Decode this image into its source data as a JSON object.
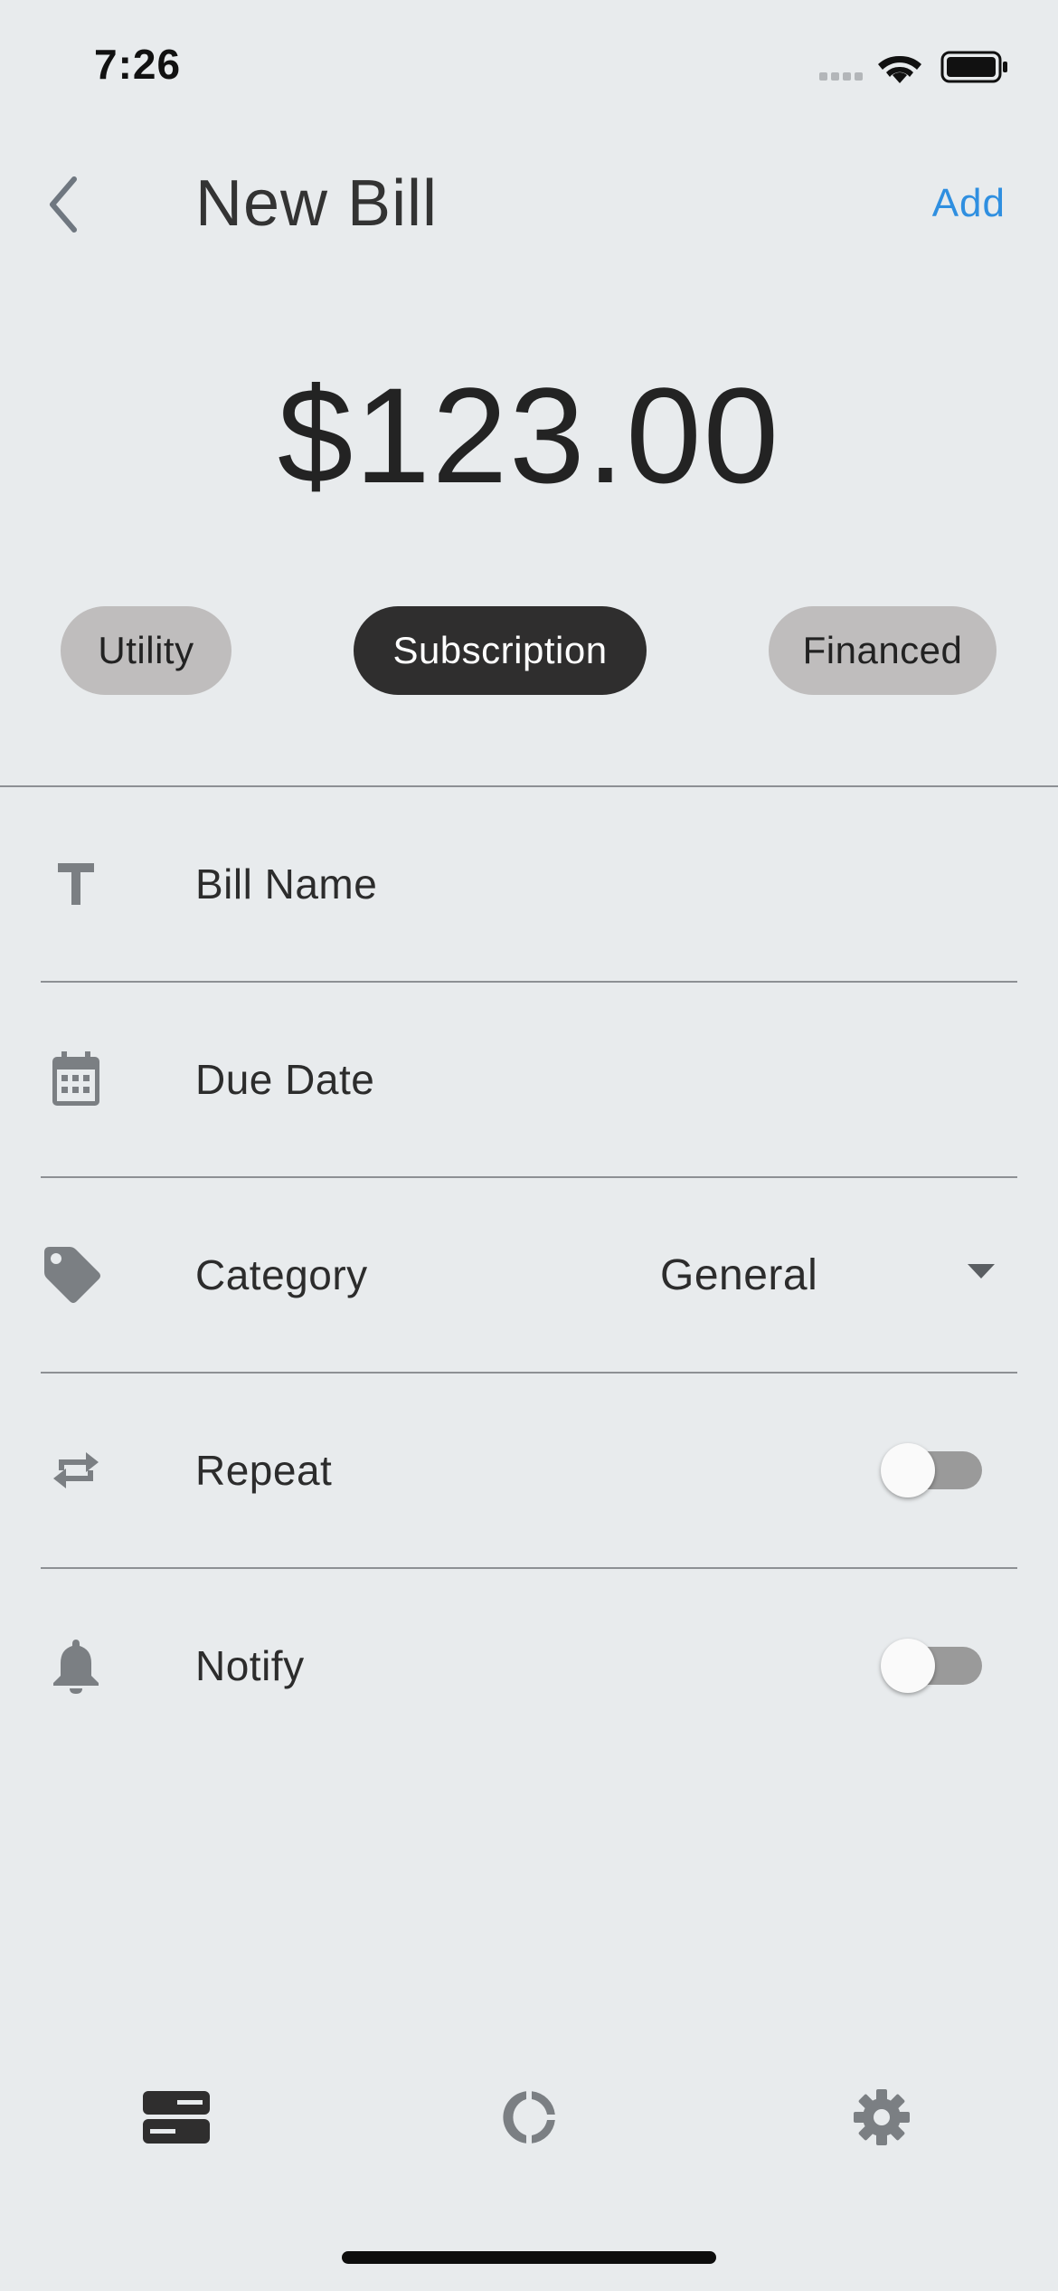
{
  "status_bar": {
    "time": "7:26",
    "icons": [
      "cellular-signal-icon",
      "wifi-icon",
      "battery-icon"
    ]
  },
  "header": {
    "back_icon": "chevron-left-icon",
    "title": "New Bill",
    "action_label": "Add"
  },
  "amount": "$123.00",
  "bill_types": [
    {
      "label": "Utility",
      "selected": false
    },
    {
      "label": "Subscription",
      "selected": true
    },
    {
      "label": "Financed",
      "selected": false
    }
  ],
  "form": {
    "bill_name": {
      "icon": "text-icon",
      "placeholder": "Bill Name"
    },
    "due_date": {
      "icon": "calendar-icon",
      "placeholder": "Due Date"
    },
    "category": {
      "icon": "tag-icon",
      "label": "Category",
      "value": "General"
    },
    "repeat": {
      "icon": "repeat-icon",
      "label": "Repeat",
      "enabled": false
    },
    "notify": {
      "icon": "bell-icon",
      "label": "Notify",
      "enabled": false
    }
  },
  "tab_bar": {
    "tabs": [
      {
        "icon": "bills-list-icon",
        "active": true
      },
      {
        "icon": "donut-chart-icon",
        "active": false
      },
      {
        "icon": "gear-icon",
        "active": false
      }
    ]
  },
  "colors": {
    "background": "#e8ebed",
    "accent": "#2f8fe0",
    "chip_selected": "#2f2e2e",
    "chip_unselected": "#bfbdbd",
    "icon_gray": "#7b7f83"
  }
}
